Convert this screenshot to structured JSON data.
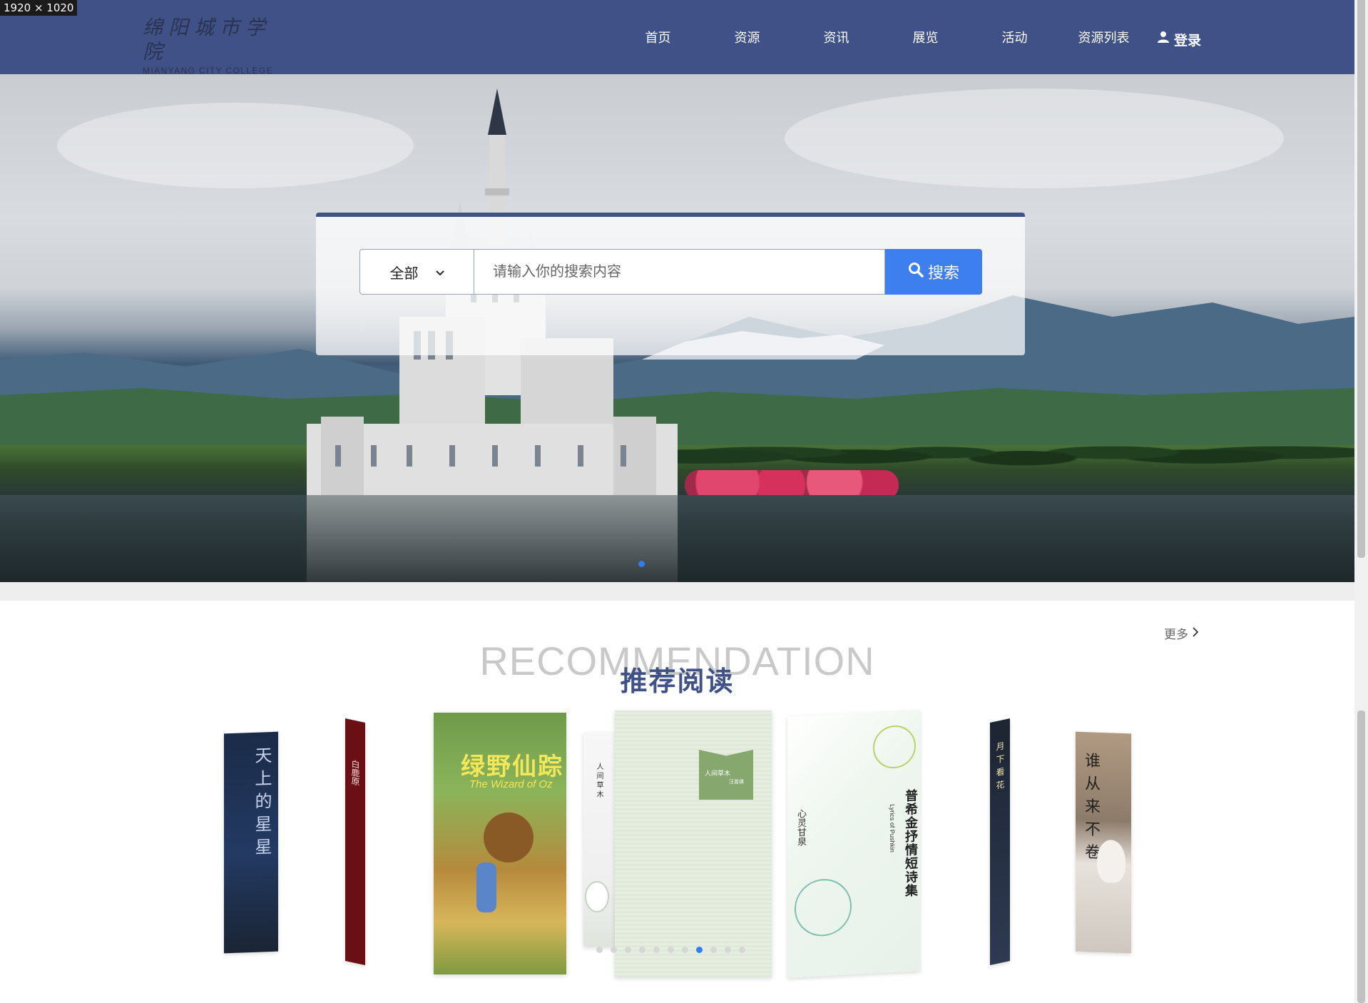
{
  "screen_label": "1920 × 1020",
  "header": {
    "logo_cn": "绵阳城市学院",
    "logo_en": "MIANYANG CITY COLLEGE",
    "nav": [
      "首页",
      "资源",
      "资讯",
      "展览",
      "活动",
      "资源列表"
    ],
    "login_label": "登录",
    "user_icon": "user-icon",
    "bg_color": "#3f5187"
  },
  "search": {
    "category_selected": "全部",
    "placeholder": "请输入你的搜索内容",
    "button_label": "搜索",
    "button_icon": "search-icon",
    "button_color": "#3d7fef"
  },
  "banner": {
    "active_slide": 1,
    "slide_count": 1
  },
  "recommendation": {
    "more_label": "更多",
    "title_en": "RECOMMENDATION",
    "title_cn": "推荐阅读",
    "books": [
      {
        "cover_text": "天上的星星"
      },
      {
        "cover_text": "白鹿原"
      },
      {
        "cover_title": "绿野仙踪",
        "cover_subtitle": "The Wizard of Oz"
      },
      {
        "cover_text": "人间草木"
      },
      {
        "cover_title": "人间草木",
        "cover_author": "汪曾祺"
      },
      {
        "cover_title": "普希金抒情短诗集",
        "cover_subtitle": "Lyrics of Pushkin",
        "cover_small": "心灵甘泉"
      },
      {
        "cover_text": "月下看花"
      },
      {
        "cover_text": "谁从来不卷"
      }
    ],
    "carousel_dot_count": 11,
    "carousel_active_dot": 7
  }
}
